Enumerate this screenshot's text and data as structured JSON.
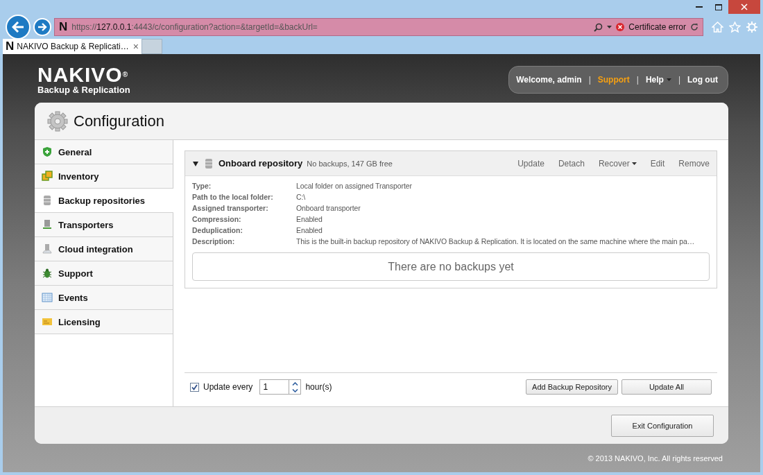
{
  "browser": {
    "address": {
      "site_icon": "N",
      "scheme": "https://",
      "host": "127.0.0.1",
      "rest": ":4443/c/configuration?action=&targetId=&backUrl="
    },
    "certificate": "Certificate error",
    "tab": {
      "site_icon": "N",
      "title": "NAKIVO Backup & Replicati…",
      "close": "×"
    }
  },
  "header": {
    "logo": {
      "name": "NAKIVO",
      "mark": "®",
      "tagline": "Backup & Replication"
    },
    "user_bar": [
      {
        "kind": "text",
        "label": "Welcome, admin"
      },
      {
        "kind": "link",
        "label": "Support",
        "highlighted": true
      },
      {
        "kind": "menu",
        "label": "Help",
        "highlighted": false
      },
      {
        "kind": "link",
        "label": "Log out",
        "highlighted": false
      }
    ],
    "separators": [
      "|",
      "|",
      "|"
    ]
  },
  "page_title": "Configuration",
  "sidebar": {
    "items": [
      {
        "label": "General",
        "selected": false
      },
      {
        "label": "Inventory",
        "selected": false
      },
      {
        "label": "Backup repositories",
        "selected": true
      },
      {
        "label": "Transporters",
        "selected": false
      },
      {
        "label": "Cloud integration",
        "selected": false
      },
      {
        "label": "Support",
        "selected": false
      },
      {
        "label": "Events",
        "selected": false
      },
      {
        "label": "Licensing",
        "selected": false
      }
    ]
  },
  "repository": {
    "expanded": true,
    "name": "Onboard repository",
    "summary": "No backups, 147 GB free",
    "actions": [
      {
        "label": "Update",
        "dropdown": false
      },
      {
        "label": "Detach",
        "dropdown": false
      },
      {
        "label": "Recover",
        "dropdown": true
      },
      {
        "label": "Edit",
        "dropdown": false
      },
      {
        "label": "Remove",
        "dropdown": false
      }
    ],
    "details": [
      {
        "label": "Type:",
        "value": "Local folder on assigned Transporter"
      },
      {
        "label": "Path to the local folder:",
        "value": "C:\\"
      },
      {
        "label": "Assigned transporter:",
        "value": "Onboard transporter"
      },
      {
        "label": "Compression:",
        "value": "Enabled"
      },
      {
        "label": "Deduplication:",
        "value": "Enabled"
      },
      {
        "label": "Description:",
        "value": "This is the built-in backup repository of NAKIVO Backup & Replication. It is located on the same machine where the main pa…"
      }
    ],
    "empty_message": "There are no backups yet"
  },
  "auto_update": {
    "checked": true,
    "label": "Update every",
    "value": "1",
    "unit": "hour(s)"
  },
  "buttons": [
    "Add Backup Repository",
    "Update All"
  ],
  "exit_button": "Exit Configuration",
  "copyright": "© 2013 NAKIVO, Inc. All rights reserved"
}
